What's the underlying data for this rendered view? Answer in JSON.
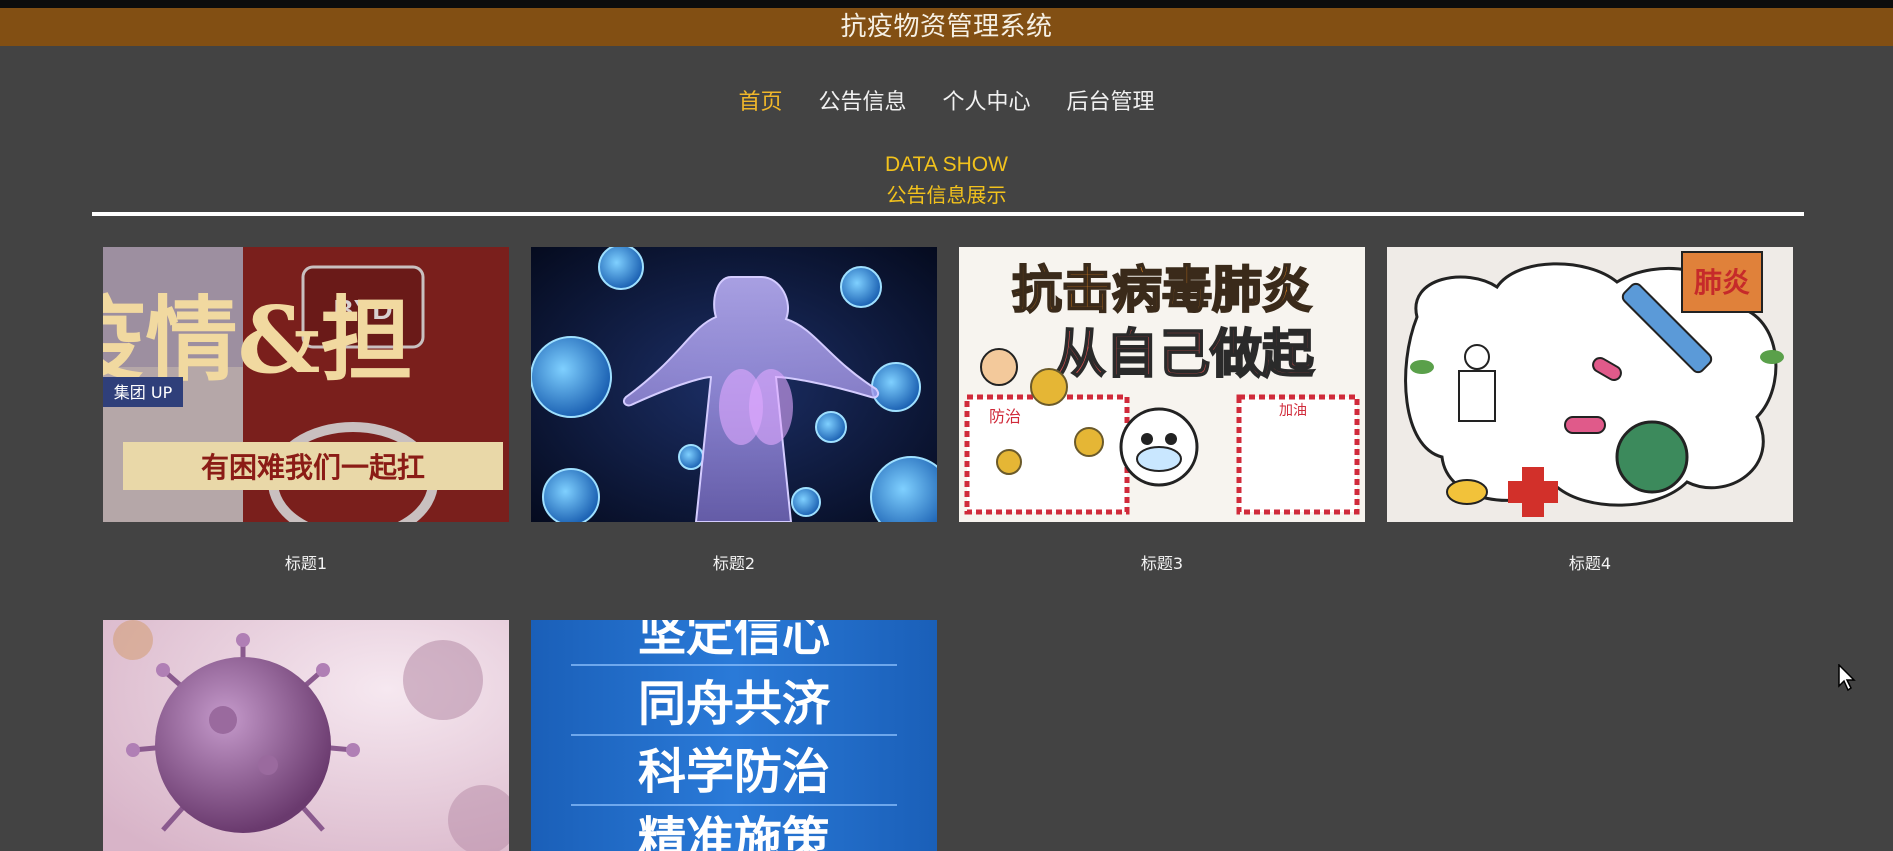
{
  "header": {
    "title": "抗疫物资管理系统"
  },
  "nav": {
    "items": [
      {
        "label": "首页"
      },
      {
        "label": "公告信息"
      },
      {
        "label": "个人中心"
      },
      {
        "label": "后台管理"
      }
    ]
  },
  "section": {
    "title_en": "DATA SHOW",
    "title_cn": "公告信息展示"
  },
  "cards": [
    {
      "caption": "标题1",
      "image_text_top": "疫情&担",
      "image_text_brand": "BYD",
      "image_text_logo": "集团 UP",
      "image_text_banner": "有困难我们一起扛"
    },
    {
      "caption": "标题2"
    },
    {
      "caption": "标题3",
      "image_text_line1": "抗击病毒肺炎",
      "image_text_line2": "从自己做起",
      "image_text_box1_title": "防治",
      "image_text_box2_title": "加油"
    },
    {
      "caption": "标题4",
      "image_text_corner": "肺炎"
    },
    {
      "caption": ""
    },
    {
      "caption": "",
      "image_lines": [
        "坚定信心",
        "同舟共济",
        "科学防治",
        "精准施策"
      ]
    }
  ],
  "colors": {
    "page_bg": "#434343",
    "title_bar": "#824f13",
    "accent_yellow": "#f2c21c",
    "nav_active": "#f0b72a"
  }
}
